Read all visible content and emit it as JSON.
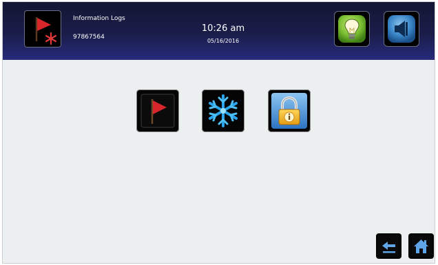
{
  "header": {
    "title": "Information Logs",
    "serial": "97867564",
    "time": "10:26 am",
    "date": "05/16/2016",
    "icons": {
      "mode": "red-flag-with-snowflake-icon",
      "light": "lightbulb-icon",
      "sound": "speaker-icon"
    }
  },
  "tiles": [
    {
      "name": "alarm-log",
      "icon": "red-flag-icon"
    },
    {
      "name": "defrost-log",
      "icon": "snowflake-icon"
    },
    {
      "name": "security-log",
      "icon": "padlock-info-icon"
    }
  ],
  "nav": {
    "back_icon": "back-arrow-icon",
    "home_icon": "home-icon"
  },
  "colors": {
    "header_dark": "#141633",
    "header_light": "#272b7a",
    "background": "#eceff0",
    "flag_red": "#d9262b",
    "snow_blue": "#2aa4ea",
    "bulb_green": "#8ac83c",
    "speaker_blue": "#3a86c8"
  }
}
